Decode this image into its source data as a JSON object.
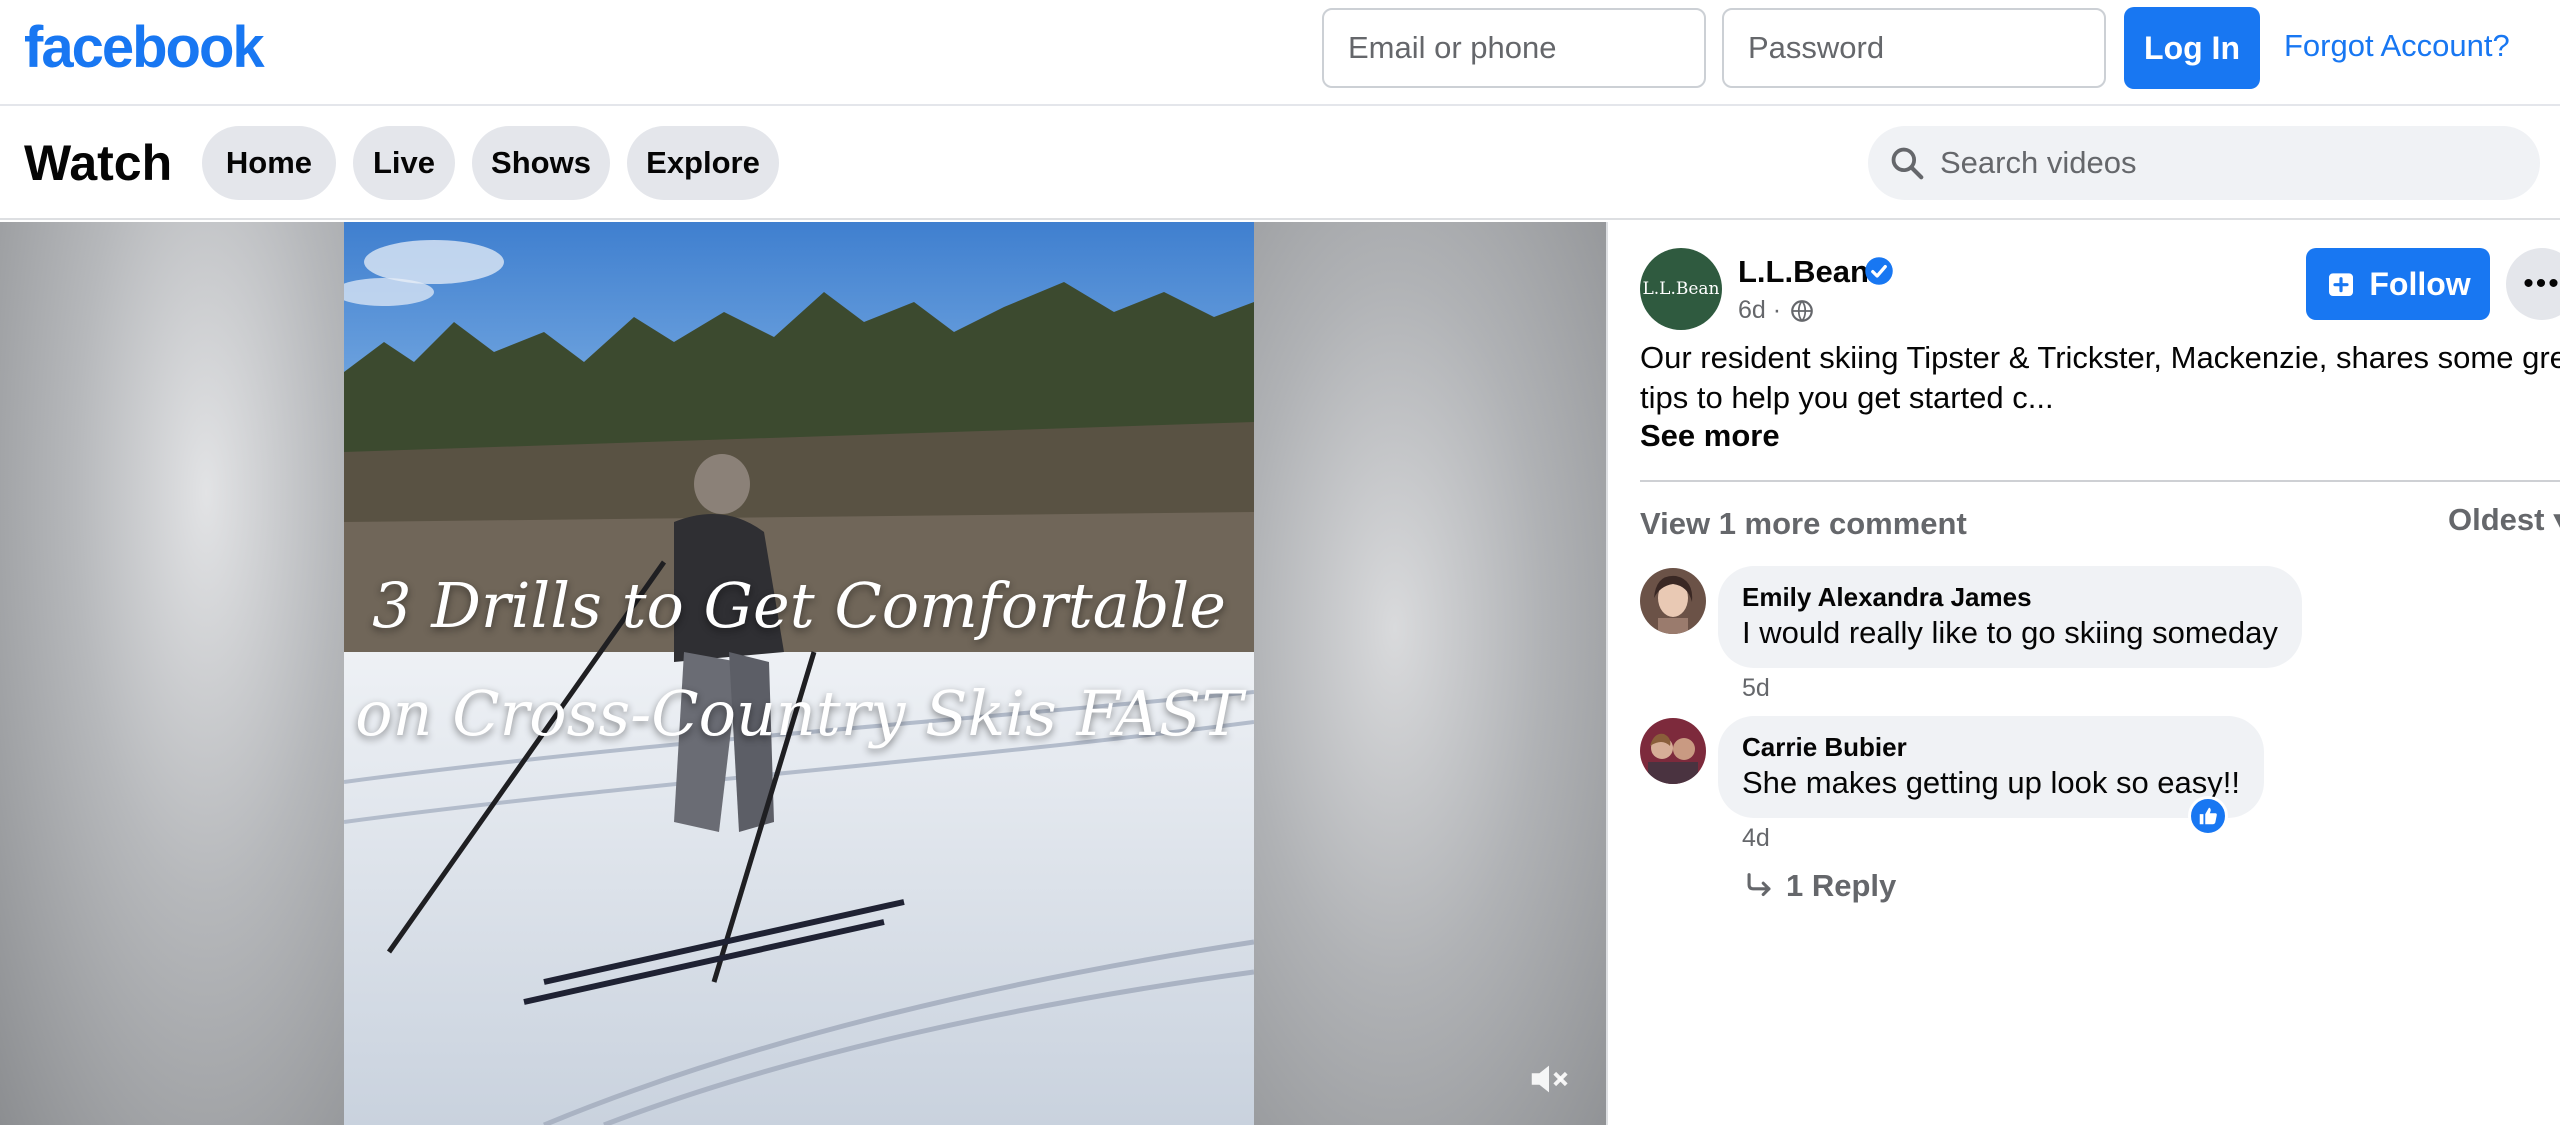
{
  "topbar": {
    "logo": "facebook",
    "email_placeholder": "Email or phone",
    "password_placeholder": "Password",
    "login_label": "Log In",
    "forgot_label": "Forgot Account?"
  },
  "watchbar": {
    "title": "Watch",
    "tabs": [
      {
        "label": "Home"
      },
      {
        "label": "Live"
      },
      {
        "label": "Shows"
      },
      {
        "label": "Explore"
      }
    ],
    "search_placeholder": "Search videos"
  },
  "video": {
    "overlay_line1": "3 Drills to Get Comfortable",
    "overlay_line2": "on Cross-Country Skis FAST",
    "muted": true
  },
  "post": {
    "page_name": "L.L.Bean",
    "avatar_text": "L.L.Bean",
    "verified": true,
    "age": "6d ·",
    "audience_icon": "globe-icon",
    "follow_label": "Follow",
    "more_label": "•••",
    "text_line1": "Our resident skiing Tipster & Trickster, Mackenzie, shares some great",
    "text_line2": "tips to help you get started c...",
    "see_more": "See more"
  },
  "comments_section": {
    "view_more": "View 1 more comment",
    "sort_label": "Oldest ▾",
    "comments": [
      {
        "author": "Emily Alexandra James",
        "text": "I would really like to go skiing someday",
        "time": "5d"
      },
      {
        "author": "Carrie Bubier",
        "text": "She makes getting up look so easy!!",
        "time": "4d",
        "reaction": "like-icon",
        "replies_label": "1 Reply"
      }
    ]
  },
  "colors": {
    "brand_blue": "#1877f2",
    "page_avatar_green": "#2f5a3f",
    "secondary_text": "#65676b",
    "pill_bg": "#e4e6eb"
  }
}
